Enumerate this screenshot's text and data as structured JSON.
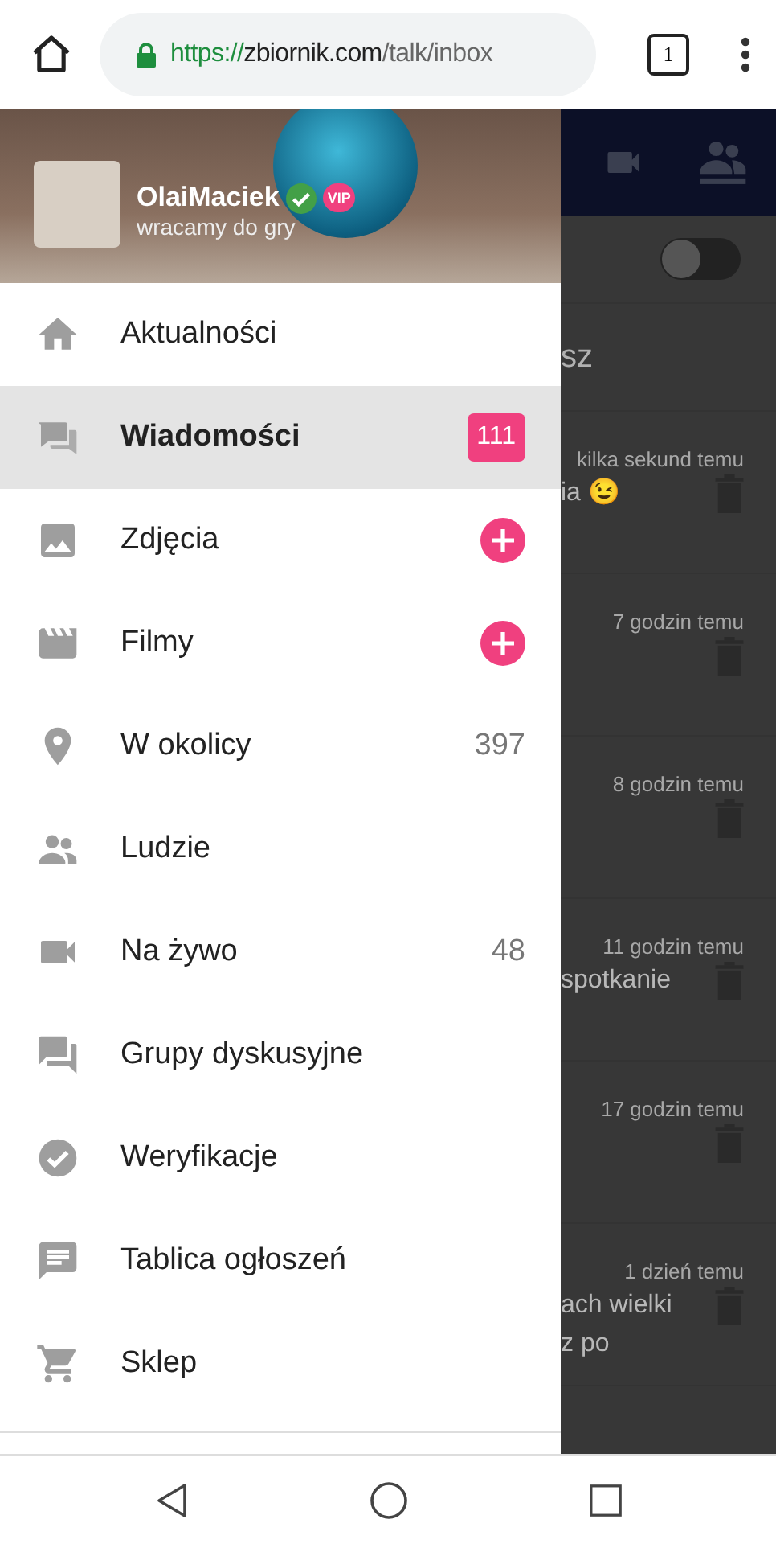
{
  "browser": {
    "url_host": "https://",
    "url_domain": "zbiornik.com",
    "url_path": "/talk/inbox",
    "tab_count": "1"
  },
  "drawer": {
    "profile": {
      "name": "OlaiMaciek",
      "verified": true,
      "badge": "VIP",
      "status": "wracamy do gry"
    },
    "items": [
      {
        "label": "Aktualności",
        "selected": false,
        "kind": "plain"
      },
      {
        "label": "Wiadomości",
        "selected": true,
        "kind": "count",
        "count": "111"
      },
      {
        "label": "Zdjęcia",
        "selected": false,
        "kind": "add"
      },
      {
        "label": "Filmy",
        "selected": false,
        "kind": "add"
      },
      {
        "label": "W okolicy",
        "selected": false,
        "kind": "number",
        "count": "397"
      },
      {
        "label": "Ludzie",
        "selected": false,
        "kind": "plain"
      },
      {
        "label": "Na żywo",
        "selected": false,
        "kind": "number",
        "count": "48"
      },
      {
        "label": "Grupy dyskusyjne",
        "selected": false,
        "kind": "plain"
      },
      {
        "label": "Weryfikacje",
        "selected": false,
        "kind": "plain"
      },
      {
        "label": "Tablica ogłoszeń",
        "selected": false,
        "kind": "plain"
      },
      {
        "label": "Sklep",
        "selected": false,
        "kind": "plain"
      }
    ]
  },
  "background": {
    "toggle": {
      "on": false
    },
    "heading": "sz",
    "messages": [
      {
        "time": "kilka sekund temu",
        "lines": [
          "ia 😉"
        ]
      },
      {
        "time": "7 godzin temu"
      },
      {
        "time": "8 godzin temu"
      },
      {
        "time": "11 godzin temu",
        "lines": [
          "spotkanie"
        ]
      },
      {
        "time": "17 godzin temu"
      },
      {
        "time": "1 dzień temu",
        "lines": [
          "ach wielki",
          "z po"
        ]
      }
    ]
  }
}
